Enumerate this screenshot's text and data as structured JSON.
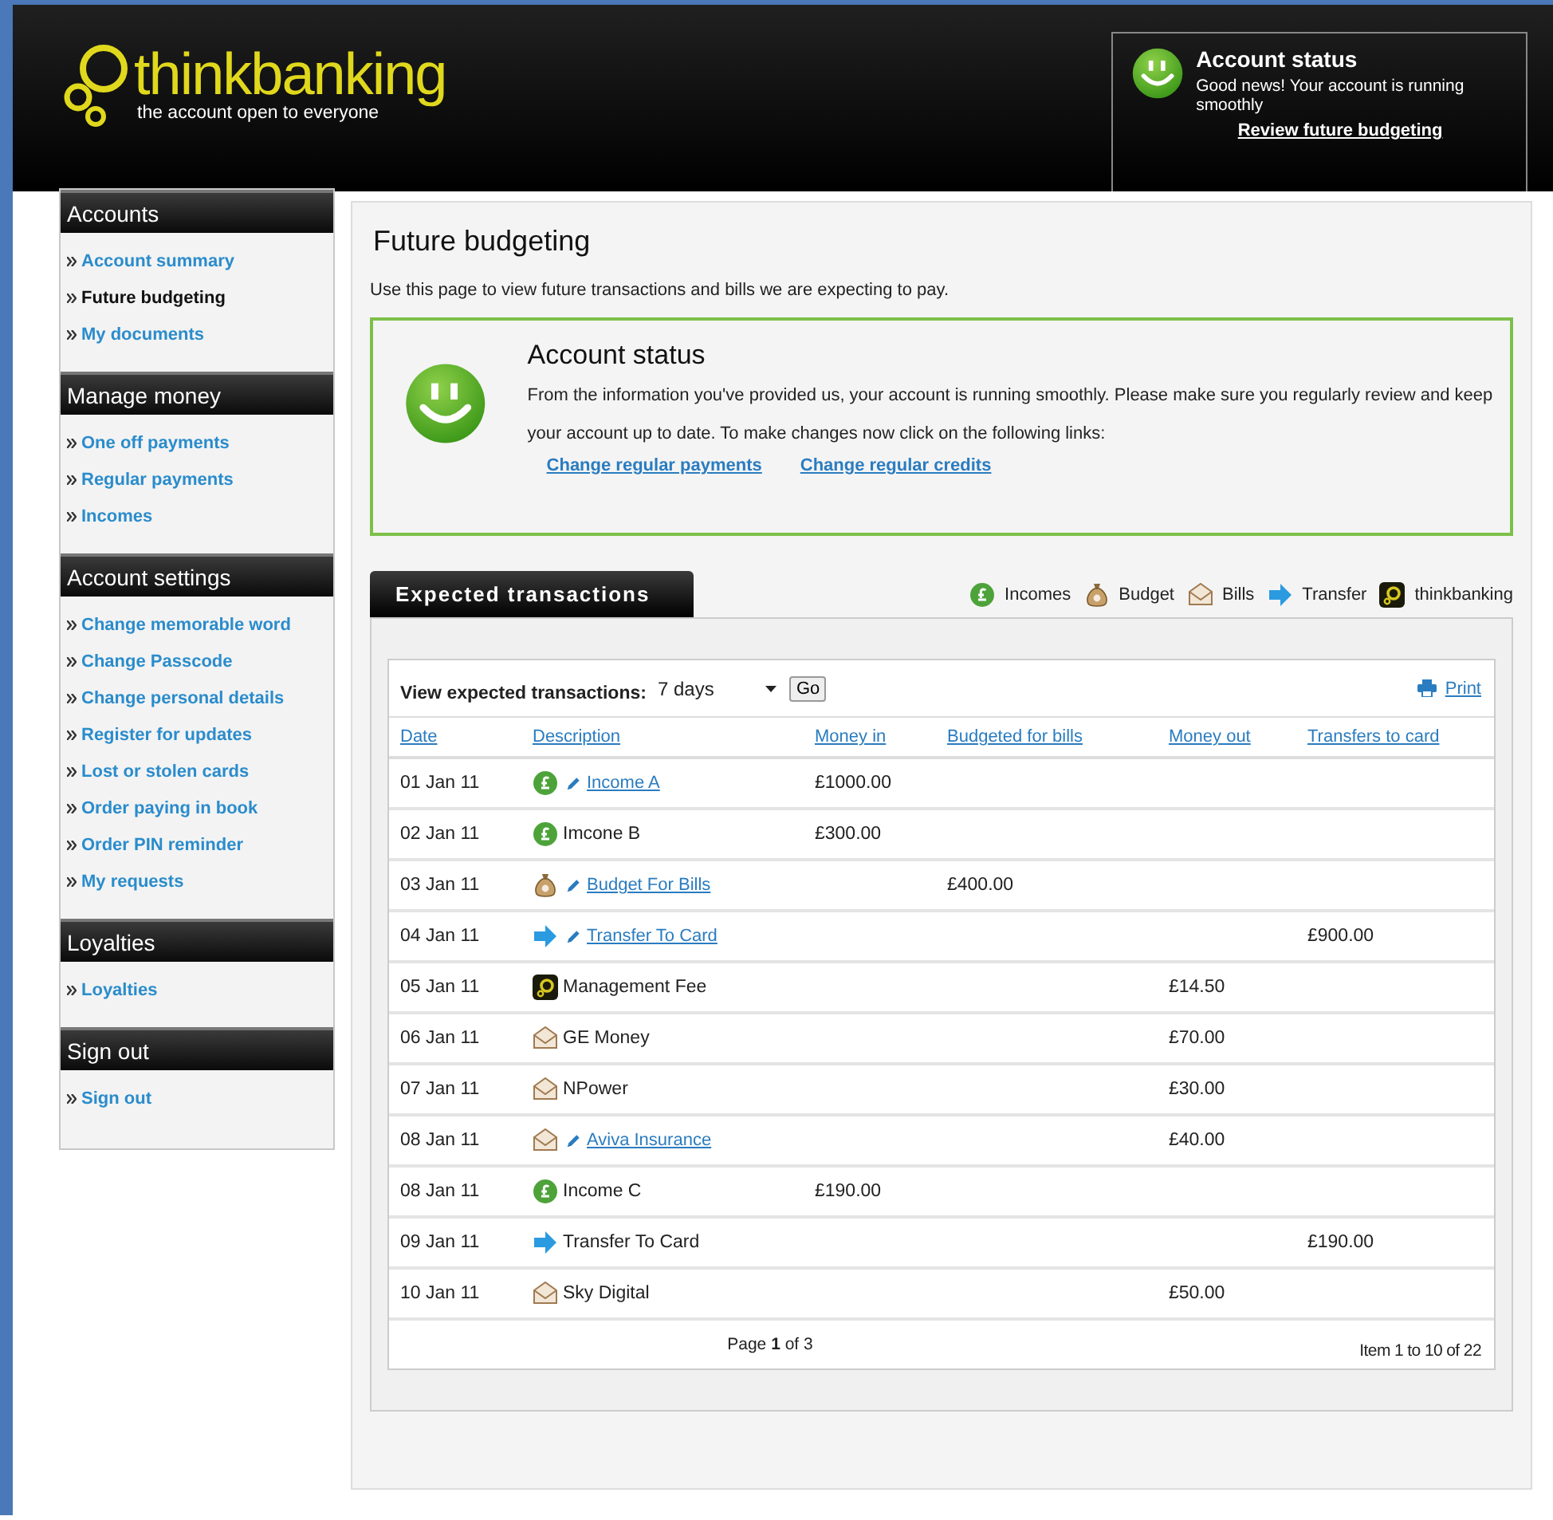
{
  "header": {
    "logo_text": "thinkbanking",
    "tagline": "the account open to everyone",
    "status": {
      "title": "Account status",
      "message": "Good news! Your account is running smoothly",
      "link": "Review future budgeting"
    }
  },
  "sidebar": [
    {
      "title": "Accounts",
      "items": [
        {
          "label": "Account summary",
          "selected": false
        },
        {
          "label": "Future budgeting",
          "selected": true
        },
        {
          "label": "My documents",
          "selected": false
        }
      ]
    },
    {
      "title": "Manage money",
      "items": [
        {
          "label": "One off payments",
          "selected": false
        },
        {
          "label": "Regular payments",
          "selected": false
        },
        {
          "label": "Incomes",
          "selected": false
        }
      ]
    },
    {
      "title": "Account settings",
      "items": [
        {
          "label": "Change memorable word",
          "selected": false
        },
        {
          "label": "Change Passcode",
          "selected": false
        },
        {
          "label": "Change personal details",
          "selected": false
        },
        {
          "label": "Register for updates",
          "selected": false
        },
        {
          "label": "Lost or stolen cards",
          "selected": false
        },
        {
          "label": "Order paying in book",
          "selected": false
        },
        {
          "label": "Order PIN reminder",
          "selected": false
        },
        {
          "label": "My requests",
          "selected": false
        }
      ]
    },
    {
      "title": "Loyalties",
      "items": [
        {
          "label": "Loyalties",
          "selected": false
        }
      ]
    },
    {
      "title": "Sign out",
      "items": [
        {
          "label": "Sign out",
          "selected": false
        }
      ]
    }
  ],
  "page": {
    "title": "Future budgeting",
    "intro": "Use this page to view future transactions and bills we are expecting to pay.",
    "status_box": {
      "title": "Account status",
      "message": "From the information you've provided us, your account is running smoothly. Please make sure you regularly review and keep your account up to date. To make changes now click on the following links:",
      "links": [
        "Change regular payments",
        "Change regular credits"
      ]
    }
  },
  "transactions": {
    "tab": "Expected transactions",
    "legend": [
      {
        "kind": "income",
        "label": "Incomes"
      },
      {
        "kind": "budget",
        "label": "Budget"
      },
      {
        "kind": "bill",
        "label": "Bills"
      },
      {
        "kind": "transfer",
        "label": "Transfer"
      },
      {
        "kind": "thinkbanking",
        "label": "thinkbanking"
      }
    ],
    "filter_label": "View expected transactions:",
    "period": "7 days",
    "go": "Go",
    "print": "Print",
    "columns": [
      "Date",
      "Description",
      "Money in",
      "Budgeted for bills",
      "Money out",
      "Transfers to card"
    ],
    "rows": [
      {
        "date": "01 Jan 11",
        "kind": "income",
        "editable": true,
        "description": "Income A",
        "money_in": "£1000.00"
      },
      {
        "date": "02 Jan 11",
        "kind": "income",
        "editable": false,
        "description": "Imcone B",
        "money_in": "£300.00"
      },
      {
        "date": "03 Jan 11",
        "kind": "budget",
        "editable": true,
        "description": "Budget For Bills",
        "budgeted_for_bills": "£400.00"
      },
      {
        "date": "04 Jan 11",
        "kind": "transfer",
        "editable": true,
        "description": "Transfer To Card",
        "transfers_to_card": "£900.00"
      },
      {
        "date": "05 Jan 11",
        "kind": "thinkbanking",
        "editable": false,
        "description": "Management Fee",
        "money_out": "£14.50"
      },
      {
        "date": "06 Jan 11",
        "kind": "bill",
        "editable": false,
        "description": "GE Money",
        "money_out": "£70.00"
      },
      {
        "date": "07 Jan 11",
        "kind": "bill",
        "editable": false,
        "description": "NPower",
        "money_out": "£30.00"
      },
      {
        "date": "08 Jan 11",
        "kind": "bill",
        "editable": true,
        "description": "Aviva Insurance",
        "money_out": "£40.00"
      },
      {
        "date": "08 Jan 11",
        "kind": "income",
        "editable": false,
        "description": "Income C",
        "money_in": "£190.00"
      },
      {
        "date": "09 Jan 11",
        "kind": "transfer",
        "editable": false,
        "description": "Transfer To Card",
        "transfers_to_card": "£190.00"
      },
      {
        "date": "10 Jan 11",
        "kind": "bill",
        "editable": false,
        "description": "Sky Digital",
        "money_out": "£50.00"
      }
    ],
    "pager": "Page **1** of 3",
    "count": "Item 1 to 10 of 22"
  }
}
